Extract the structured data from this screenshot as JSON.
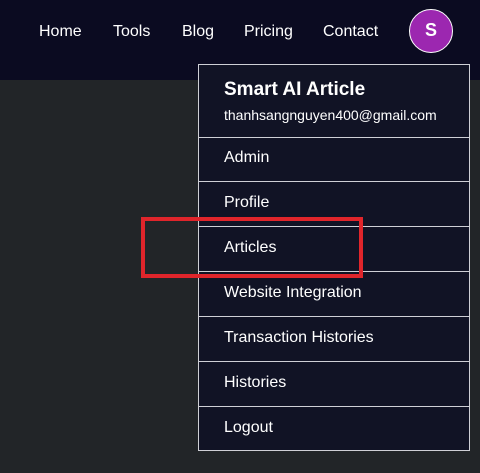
{
  "nav": {
    "links": [
      "Home",
      "Tools",
      "Blog",
      "Pricing",
      "Contact"
    ],
    "avatar_initial": "S"
  },
  "dropdown": {
    "app_name": "Smart AI Article",
    "email": "thanhsangnguyen400@gmail.com",
    "items": [
      "Admin",
      "Profile",
      "Articles",
      "Website Integration",
      "Transaction Histories",
      "Histories",
      "Logout"
    ]
  },
  "colors": {
    "topbar_bg": "#0b0b21",
    "page_bg": "#222528",
    "dropdown_bg": "#111325",
    "avatar_bg": "#9c27b0",
    "highlight": "#e0252b"
  }
}
